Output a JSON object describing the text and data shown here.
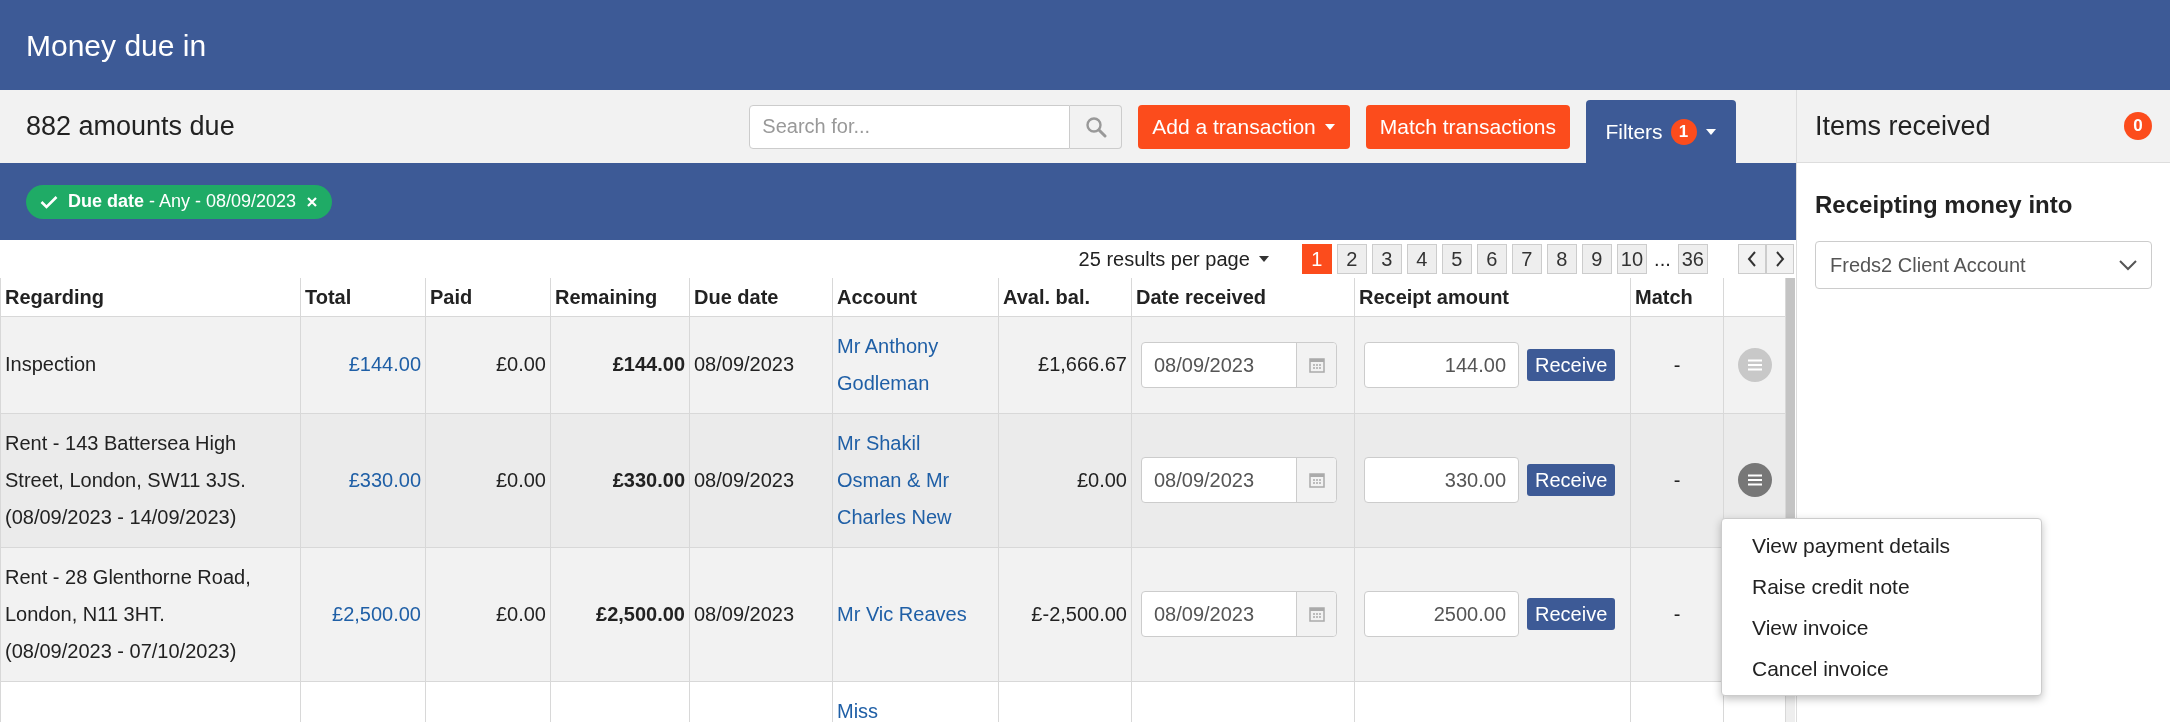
{
  "header": {
    "title": "Money due in"
  },
  "toolbar": {
    "count": "882 amounts due",
    "search": {
      "placeholder": "Search for..."
    },
    "buttons": [
      {
        "label": "Add a transaction",
        "dropdown": true
      },
      {
        "label": "Match transactions",
        "dropdown": false
      }
    ],
    "filters_tab": {
      "label": "Filters",
      "badge": "1",
      "selected": true
    }
  },
  "active_filters": [
    {
      "label": "**Due date** - Any - 08/09/2023"
    }
  ],
  "pagination": {
    "per_page": "25 results per page",
    "pages": [
      {
        "kind": "page",
        "label": "1",
        "selected": true
      },
      {
        "kind": "page",
        "label": "2",
        "selected": false
      },
      {
        "kind": "page",
        "label": "3",
        "selected": false
      },
      {
        "kind": "page",
        "label": "4",
        "selected": false
      },
      {
        "kind": "page",
        "label": "5",
        "selected": false
      },
      {
        "kind": "page",
        "label": "6",
        "selected": false
      },
      {
        "kind": "page",
        "label": "7",
        "selected": false
      },
      {
        "kind": "page",
        "label": "8",
        "selected": false
      },
      {
        "kind": "page",
        "label": "9",
        "selected": false
      },
      {
        "kind": "page",
        "label": "10",
        "selected": false
      },
      {
        "kind": "gap",
        "label": "..."
      },
      {
        "kind": "page",
        "label": "36",
        "selected": false
      }
    ]
  },
  "table": {
    "columns": [
      "Regarding",
      "Total",
      "Paid",
      "Remaining",
      "Due date",
      "Account",
      "Aval. bal.",
      "Date received",
      "Receipt amount",
      "Match"
    ],
    "rows": [
      {
        "regarding": "Inspection",
        "total": "£144.00",
        "paid": "£0.00",
        "remaining": "£144.00",
        "due_date": "08/09/2023",
        "account": "Mr Anthony Godleman",
        "aval_bal": "£1,666.67",
        "date_received": "08/09/2023",
        "receipt_amount": "144.00",
        "receive_button": "Receive",
        "match": "-",
        "actions_open": false
      },
      {
        "regarding": "Rent - 143 Battersea High Street, London, SW11 3JS. (08/09/2023 - 14/09/2023)",
        "total": "£330.00",
        "paid": "£0.00",
        "remaining": "£330.00",
        "due_date": "08/09/2023",
        "account": "Mr Shakil Osman & Mr Charles New",
        "aval_bal": "£0.00",
        "date_received": "08/09/2023",
        "receipt_amount": "330.00",
        "receive_button": "Receive",
        "match": "-",
        "actions_open": true
      },
      {
        "regarding": "Rent - 28 Glenthorne Road, London, N11 3HT. (08/09/2023 - 07/10/2023)",
        "total": "£2,500.00",
        "paid": "£0.00",
        "remaining": "£2,500.00",
        "due_date": "08/09/2023",
        "account": "Mr Vic Reaves",
        "aval_bal": "£-2,500.00",
        "date_received": "08/09/2023",
        "receipt_amount": "2500.00",
        "receive_button": "Receive",
        "match": "-"
      },
      {
        "account": "Miss"
      }
    ]
  },
  "row_menu": {
    "items": [
      "View payment details",
      "Raise credit note",
      "View invoice",
      "Cancel invoice"
    ]
  },
  "side_panel": {
    "title": "Items received",
    "badge": "0",
    "section_title": "Receipting money into",
    "account_select": {
      "value": "Freds2 Client Account"
    }
  }
}
